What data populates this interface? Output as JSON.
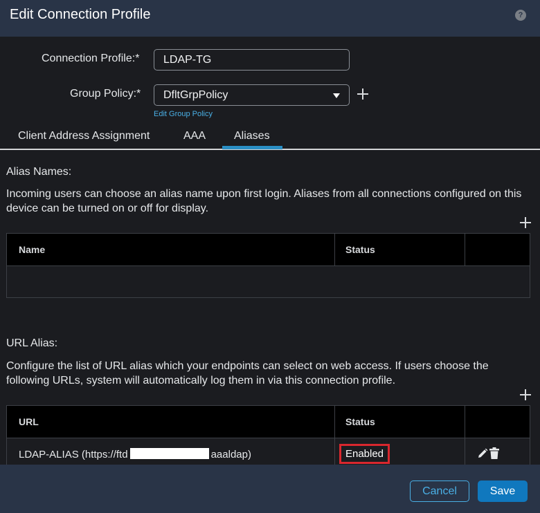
{
  "header": {
    "title": "Edit Connection Profile",
    "help_icon": "?"
  },
  "form": {
    "connection_profile_label": "Connection Profile:*",
    "connection_profile_value": "LDAP-TG",
    "group_policy_label": "Group Policy:*",
    "group_policy_value": "DfltGrpPolicy",
    "edit_group_policy_link": "Edit Group Policy"
  },
  "tabs": [
    {
      "label": "Client Address Assignment",
      "active": false
    },
    {
      "label": "AAA",
      "active": false
    },
    {
      "label": "Aliases",
      "active": true
    }
  ],
  "alias_names": {
    "title": "Alias Names:",
    "description": "Incoming users can choose an alias name upon first login. Aliases from all connections configured on this device can be turned on or off for display.",
    "columns": [
      "Name",
      "Status"
    ],
    "rows": []
  },
  "url_alias": {
    "title": "URL Alias:",
    "description": "Configure the list of URL alias which your endpoints can select on web access. If users choose the following URLs, system will automatically log them in via this connection profile.",
    "columns": [
      "URL",
      "Status"
    ],
    "rows": [
      {
        "url_prefix": "LDAP-ALIAS (https://ftd",
        "url_suffix": "aaaldap)",
        "status": "Enabled"
      }
    ]
  },
  "footer": {
    "cancel_label": "Cancel",
    "save_label": "Save"
  },
  "colors": {
    "header_bg": "#293447",
    "accent": "#4ab0e6",
    "primary_button": "#1078be",
    "status_highlight": "#d9272e",
    "active_tab": "#2a8ec4"
  }
}
